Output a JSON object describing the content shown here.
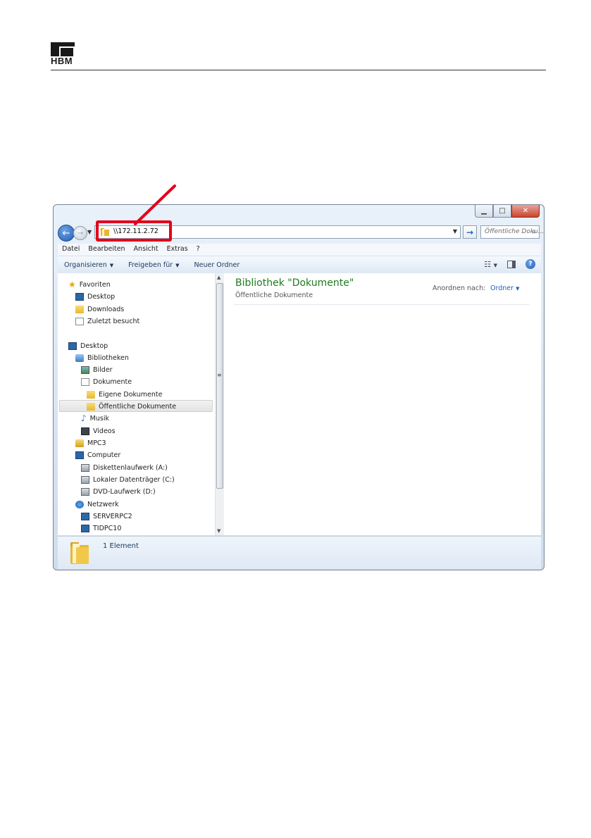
{
  "document": {
    "logo_text": "HBM"
  },
  "window": {
    "address": "\\\\172.11.2.72",
    "search_placeholder": "Öffentliche Doku...",
    "menu": [
      "Datei",
      "Bearbeiten",
      "Ansicht",
      "Extras",
      "?"
    ],
    "toolbar": {
      "organize": "Organisieren",
      "share": "Freigeben für",
      "new_folder": "Neuer Ordner"
    },
    "nav_tree": [
      {
        "label": "Favoriten",
        "icon": "star-icon"
      },
      {
        "label": "Desktop",
        "icon": "desktop-icon"
      },
      {
        "label": "Downloads",
        "icon": "folder-icon"
      },
      {
        "label": "Zuletzt besucht",
        "icon": "recent-places-icon"
      },
      {
        "label": "Desktop",
        "icon": "desktop-icon"
      },
      {
        "label": "Bibliotheken",
        "icon": "libraries-icon"
      },
      {
        "label": "Bilder",
        "icon": "pictures-icon"
      },
      {
        "label": "Dokumente",
        "icon": "documents-icon"
      },
      {
        "label": "Eigene Dokumente",
        "icon": "folder-icon"
      },
      {
        "label": "Öffentliche Dokumente",
        "icon": "folder-icon",
        "selected": true
      },
      {
        "label": "Musik",
        "icon": "music-icon"
      },
      {
        "label": "Videos",
        "icon": "videos-icon"
      },
      {
        "label": "MPC3",
        "icon": "user-folder-icon"
      },
      {
        "label": "Computer",
        "icon": "computer-icon"
      },
      {
        "label": "Diskettenlaufwerk (A:)",
        "icon": "floppy-drive-icon"
      },
      {
        "label": "Lokaler Datenträger (C:)",
        "icon": "hard-drive-icon"
      },
      {
        "label": "DVD-Laufwerk (D:)",
        "icon": "dvd-drive-icon"
      },
      {
        "label": "Netzwerk",
        "icon": "network-icon"
      },
      {
        "label": "SERVERPC2",
        "icon": "network-computer-icon"
      },
      {
        "label": "TIDPC10",
        "icon": "network-computer-icon"
      }
    ],
    "content": {
      "title": "Bibliothek \"Dokumente\"",
      "subtitle": "Öffentliche Dokumente",
      "arrange_label": "Anordnen nach:",
      "arrange_value": "Ordner"
    },
    "status": "1 Element"
  },
  "colors": {
    "annotation_red": "#e2001a",
    "library_title_green": "#1e7a1e",
    "link_blue": "#1e63c0"
  }
}
